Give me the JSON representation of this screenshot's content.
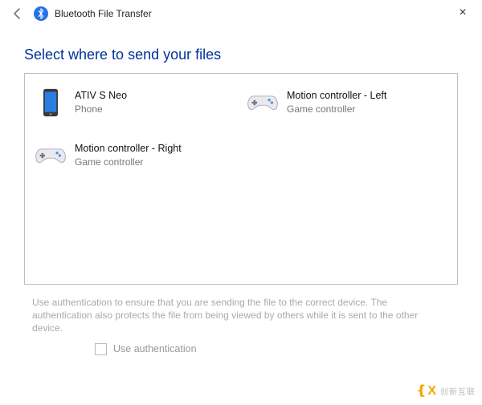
{
  "window": {
    "title": "Bluetooth File Transfer"
  },
  "heading": "Select where to send your files",
  "devices": [
    {
      "name": "ATIV S Neo",
      "type": "Phone",
      "icon": "phone"
    },
    {
      "name": "Motion controller - Left",
      "type": "Game controller",
      "icon": "gamepad"
    },
    {
      "name": "Motion controller - Right",
      "type": "Game controller",
      "icon": "gamepad"
    }
  ],
  "helptext": "Use authentication to ensure that you are sending the file to the correct device. The authentication also protects the file from being viewed by others while it is sent to the other device.",
  "auth": {
    "label": "Use authentication",
    "checked": false
  },
  "watermark": {
    "text": "创新互联"
  }
}
